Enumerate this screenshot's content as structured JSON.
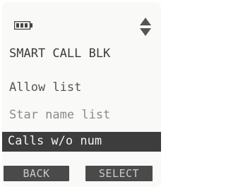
{
  "status": {
    "battery_icon": "battery-icon",
    "scroll_icon": "up-down-arrows-icon"
  },
  "menu": {
    "title": "SMART CALL BLK",
    "items": [
      {
        "label": "Allow list"
      },
      {
        "label": "Star name list"
      },
      {
        "label": "Calls w/o num",
        "selected": true
      }
    ]
  },
  "softkeys": {
    "left": "BACK",
    "right": "SELECT"
  },
  "colors": {
    "screen_bg": "#f9f9f8",
    "text": "#3a3a3a",
    "highlight": "#3d3d3d",
    "softkey_bg": "#4a4a4a"
  }
}
